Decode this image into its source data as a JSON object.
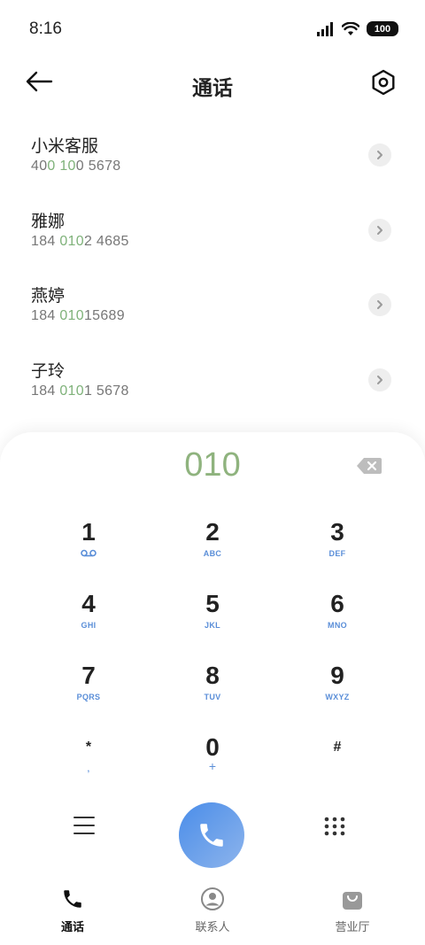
{
  "status": {
    "time": "8:16",
    "battery": "100"
  },
  "header": {
    "title": "通话"
  },
  "contacts": [
    {
      "name": "小米客服",
      "number": [
        "40",
        "0",
        " ",
        "10",
        "0 5678"
      ]
    },
    {
      "name": "雅娜",
      "number": [
        "184 ",
        "010",
        "2 4685"
      ]
    },
    {
      "name": "燕婷",
      "number": [
        "184 ",
        "010",
        "15689"
      ]
    },
    {
      "name": "子玲",
      "number": [
        "184 ",
        "010",
        "1 5678"
      ]
    }
  ],
  "dialer": {
    "input": "010",
    "keys": [
      {
        "digit": "1",
        "sub": "voicemail-icon"
      },
      {
        "digit": "2",
        "sub": "ABC"
      },
      {
        "digit": "3",
        "sub": "DEF"
      },
      {
        "digit": "4",
        "sub": "GHI"
      },
      {
        "digit": "5",
        "sub": "JKL"
      },
      {
        "digit": "6",
        "sub": "MNO"
      },
      {
        "digit": "7",
        "sub": "PQRS"
      },
      {
        "digit": "8",
        "sub": "TUV"
      },
      {
        "digit": "9",
        "sub": "WXYZ"
      },
      {
        "digit": "*",
        "sub": ","
      },
      {
        "digit": "0",
        "sub": "+"
      },
      {
        "digit": "#",
        "sub": ""
      }
    ]
  },
  "nav": [
    {
      "label": "通话",
      "icon": "phone-icon",
      "active": true
    },
    {
      "label": "联系人",
      "icon": "person-icon",
      "active": false
    },
    {
      "label": "营业厅",
      "icon": "shopping-bag-icon",
      "active": false
    }
  ],
  "colors": {
    "accent": "#5a8ed8",
    "match": "#8fb37e",
    "call": "#4a8de9"
  }
}
